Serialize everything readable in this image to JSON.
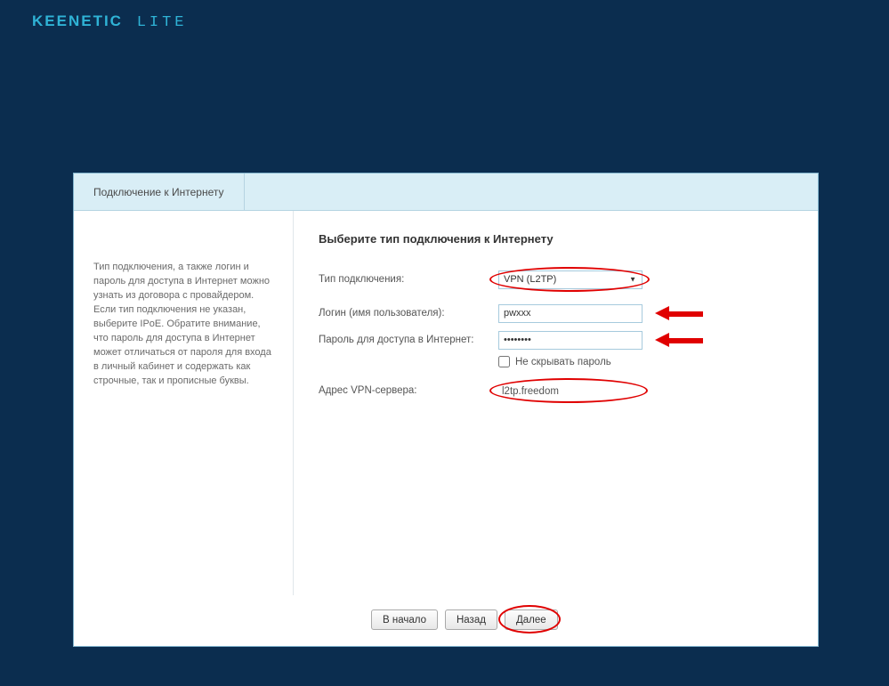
{
  "brand": "KEENETIC",
  "model": "LITE",
  "tabs": [
    {
      "label": "Подключение к Интернету"
    }
  ],
  "sidebar": {
    "help_text": "Тип подключения, а также логин и пароль для доступа в Интернет можно узнать из договора с провайдером. Если тип подключения не указан, выберите IPoE. Обратите внимание, что пароль для доступа в Интернет может отличаться от пароля для входа в личный кабинет и содержать как строчные, так и прописные буквы."
  },
  "form": {
    "heading": "Выберите тип подключения к Интернету",
    "conn_type": {
      "label": "Тип подключения:",
      "value": "VPN (L2TP)"
    },
    "login": {
      "label": "Логин (имя пользователя):",
      "value": "pwxxx"
    },
    "password": {
      "label": "Пароль для доступа в Интернет:",
      "value": "••••••••"
    },
    "show_password": {
      "label": "Не скрывать пароль",
      "checked": false
    },
    "vpn_addr": {
      "label": "Адрес VPN-сервера:",
      "value": "l2tp.freedom"
    }
  },
  "buttons": {
    "start": "В начало",
    "back": "Назад",
    "next": "Далее"
  },
  "colors": {
    "accent_red": "#e00000",
    "bg": "#0b2d4f",
    "tab_bg": "#d9eef6"
  }
}
